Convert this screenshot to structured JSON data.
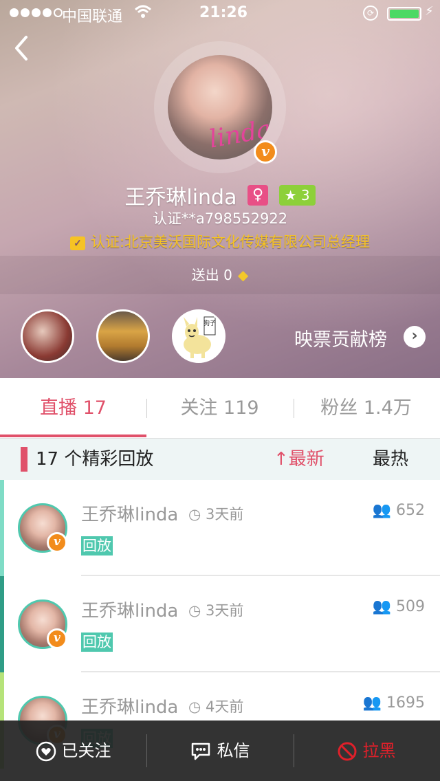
{
  "status_bar": {
    "carrier": "中国联通",
    "time": "21:26"
  },
  "profile": {
    "name": "王乔琳linda",
    "gender_symbol": "♀",
    "level": "3",
    "uid": "认证**a798552922",
    "certification": "认证:北京美沃国际文化传媒有限公司总经理",
    "sent_label": "送出 0",
    "avatar_script_text": "linda"
  },
  "contribution": {
    "label": "映票贡献榜",
    "third_avatar_text": "狗子"
  },
  "tabs": [
    {
      "label": "直播 17",
      "active": true
    },
    {
      "label": "关注 119",
      "active": false
    },
    {
      "label": "粉丝 1.4万",
      "active": false
    }
  ],
  "section": {
    "title": "17 个精彩回放",
    "sort_new": "最新",
    "sort_hot": "最热"
  },
  "replays": [
    {
      "name": "王乔琳linda",
      "ago": "3天前",
      "viewers": "652",
      "tag": "回放",
      "side_color": "#7fdcc6"
    },
    {
      "name": "王乔琳linda",
      "ago": "3天前",
      "viewers": "509",
      "tag": "回放",
      "side_color": "#2f9d86"
    },
    {
      "name": "王乔琳linda",
      "ago": "4天前",
      "viewers": "1695",
      "tag": "回放",
      "side_color": "#b6e37a"
    }
  ],
  "bottom_bar": {
    "follow": "已关注",
    "message": "私信",
    "block": "拉黑"
  },
  "colors": {
    "accent": "#e0516a",
    "teal": "#4fc8ae",
    "gold": "#f6c324",
    "level_green": "#8dd03a",
    "badge_orange": "#f28c1c",
    "block_red": "#e0202a"
  }
}
